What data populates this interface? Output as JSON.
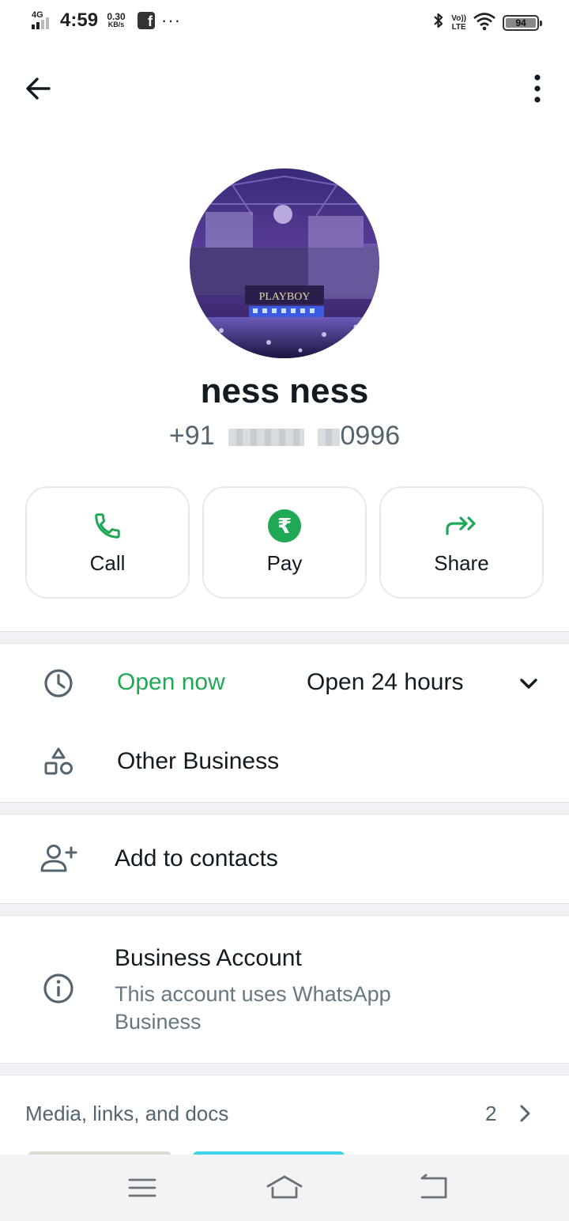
{
  "status_bar": {
    "network": "4G",
    "time": "4:59",
    "speed_value": "0.30",
    "speed_unit": "KB/s",
    "more": "···",
    "volte_top": "Vo))",
    "volte_bottom": "LTE",
    "battery": "94"
  },
  "profile": {
    "name": "ness ness",
    "phone_prefix": "+91",
    "phone_suffix": "0996"
  },
  "actions": [
    {
      "label": "Call",
      "icon": "phone-icon"
    },
    {
      "label": "Pay",
      "icon": "rupee-icon",
      "symbol": "₹"
    },
    {
      "label": "Share",
      "icon": "share-forward-icon"
    }
  ],
  "hours": {
    "status": "Open now",
    "text": "Open 24 hours"
  },
  "category": "Other Business",
  "add_contact": "Add to contacts",
  "business_account": {
    "title": "Business Account",
    "subtitle": "This account uses WhatsApp Business"
  },
  "media": {
    "title": "Media, links, and docs",
    "count": "2"
  },
  "colors": {
    "accent_green": "#1fa855",
    "text_primary": "#111b21",
    "text_secondary": "#667781",
    "divider": "#f0f2f5"
  }
}
